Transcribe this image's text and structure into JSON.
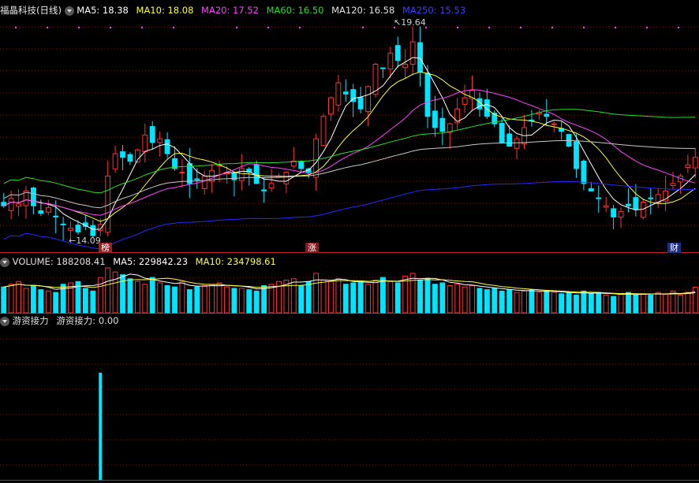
{
  "main_header": {
    "stock_name": "福晶科技(日线)",
    "ma5": "MA5: 18.38",
    "ma10": "MA10: 18.08",
    "ma20": "MA20: 17.52",
    "ma60": "MA60: 16.50",
    "ma120": "MA120: 16.58",
    "ma250": "MA250: 15.53"
  },
  "volume_header": {
    "volume": "VOLUME: 188208.41",
    "ma5": "MA5: 229842.23",
    "ma10": "MA10: 234798.61"
  },
  "indicator_header": {
    "name": "游资接力",
    "value": "游资接力: 0.00"
  },
  "annotations": {
    "high": "19.64",
    "low": "14.09"
  },
  "markers": [
    {
      "label": "榜",
      "day": 13,
      "color": "#e23a2a"
    },
    {
      "label": "涨",
      "day": 41,
      "color": "#a02020"
    },
    {
      "label": "财",
      "day": 89,
      "color": "#2040a0"
    }
  ],
  "colors": {
    "up": "#ff3232",
    "down": "#00e5ff",
    "ma5": "#ffffff",
    "ma10": "#ffff3c",
    "ma20": "#ff40ff",
    "ma60": "#28e028",
    "ma120": "#c8c8c8",
    "ma250": "#2828ff",
    "grid": "#7a1010"
  },
  "chart_data": {
    "type": "candlestick",
    "days": 94,
    "price_range": [
      13.8,
      20.1
    ],
    "closes": [
      15.0,
      15.2,
      15.05,
      15.4,
      15.0,
      14.8,
      14.95,
      14.7,
      14.5,
      14.4,
      14.3,
      14.45,
      14.2,
      14.5,
      15.8,
      16.4,
      16.3,
      16.2,
      16.5,
      16.9,
      16.7,
      16.8,
      16.4,
      16.0,
      15.9,
      15.6,
      15.7,
      15.8,
      15.95,
      16.1,
      15.9,
      15.7,
      16.0,
      15.9,
      15.6,
      15.4,
      15.6,
      15.8,
      15.9,
      16.2,
      16.0,
      15.9,
      16.8,
      17.4,
      17.9,
      18.3,
      18.0,
      17.8,
      17.6,
      18.2,
      18.8,
      18.7,
      19.1,
      18.9,
      18.8,
      19.4,
      18.6,
      17.4,
      17.1,
      17.0,
      17.2,
      17.6,
      17.9,
      18.1,
      17.6,
      17.4,
      17.2,
      16.7,
      16.6,
      16.8,
      17.1,
      17.3,
      17.5,
      17.4,
      17.2,
      17.0,
      16.6,
      16.0,
      15.6,
      15.4,
      15.2,
      15.0,
      14.7,
      14.85,
      15.0,
      14.9,
      15.1,
      15.2,
      15.3,
      15.4,
      15.6,
      15.8,
      16.1,
      16.3
    ],
    "volume_scale_max": 330000,
    "volumes": [
      190,
      210,
      230,
      180,
      200,
      170,
      160,
      150,
      210,
      220,
      230,
      180,
      160,
      260,
      330,
      300,
      280,
      250,
      230,
      210,
      260,
      220,
      200,
      190,
      230,
      170,
      190,
      200,
      210,
      220,
      190,
      180,
      180,
      170,
      160,
      200,
      210,
      230,
      240,
      250,
      200,
      230,
      290,
      240,
      230,
      250,
      210,
      220,
      230,
      210,
      240,
      260,
      230,
      220,
      270,
      290,
      240,
      250,
      210,
      220,
      200,
      210,
      190,
      200,
      180,
      170,
      180,
      160,
      170,
      150,
      160,
      170,
      150,
      160,
      150,
      140,
      150,
      130,
      160,
      140,
      150,
      130,
      120,
      140,
      150,
      130,
      140,
      130,
      150,
      140,
      160,
      130,
      150,
      188
    ],
    "indicator_spike_day": 13,
    "indicator_value": 0.0
  }
}
